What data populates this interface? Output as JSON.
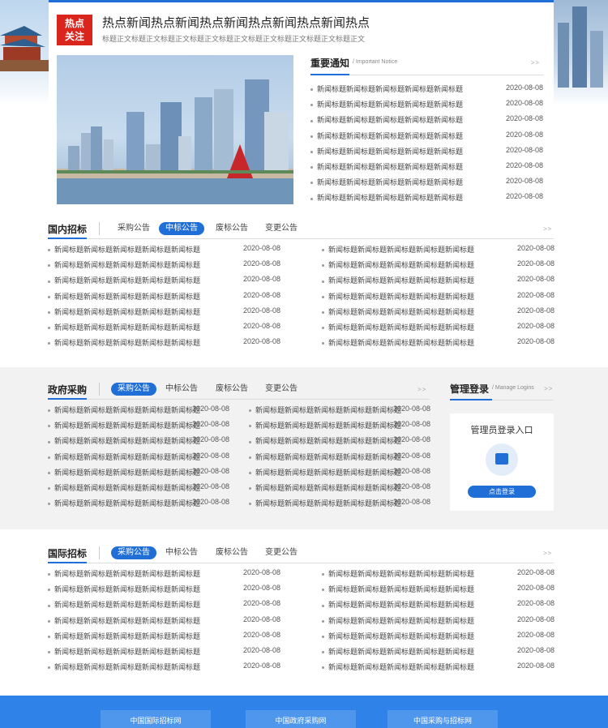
{
  "hot": {
    "badge_line1": "热点",
    "badge_line2": "关注",
    "title": "热点新闻热点新闻热点新闻热点新闻热点新闻热点",
    "subtitle": "标题正文标题正文标题正文标题正文标题正文标题正文标题正文标题正文标题正文"
  },
  "notice": {
    "title": "重要通知",
    "subtitle": "/ Important Notice",
    "more": ">>",
    "items": [
      {
        "text": "新闻标题新闻标题新闻标题新闻标题新闻标题",
        "date": "2020-08-08"
      },
      {
        "text": "新闻标题新闻标题新闻标题新闻标题新闻标题",
        "date": "2020-08-08"
      },
      {
        "text": "新闻标题新闻标题新闻标题新闻标题新闻标题",
        "date": "2020-08-08"
      },
      {
        "text": "新闻标题新闻标题新闻标题新闻标题新闻标题",
        "date": "2020-08-08"
      },
      {
        "text": "新闻标题新闻标题新闻标题新闻标题新闻标题",
        "date": "2020-08-08"
      },
      {
        "text": "新闻标题新闻标题新闻标题新闻标题新闻标题",
        "date": "2020-08-08"
      },
      {
        "text": "新闻标题新闻标题新闻标题新闻标题新闻标题",
        "date": "2020-08-08"
      },
      {
        "text": "新闻标题新闻标题新闻标题新闻标题新闻标题",
        "date": "2020-08-08"
      }
    ]
  },
  "domestic": {
    "title": "国内招标",
    "tabs": [
      "采购公告",
      "中标公告",
      "废标公告",
      "变更公告"
    ],
    "active_tab": 1,
    "more": ">>",
    "item_text": "新闻标题新闻标题新闻标题新闻标题新闻标题",
    "item_date": "2020-08-08",
    "rows": 7
  },
  "gov": {
    "title": "政府采购",
    "tabs": [
      "采购公告",
      "中标公告",
      "废标公告",
      "变更公告"
    ],
    "active_tab": 0,
    "more": ">>",
    "item_text": "新闻标题新闻标题新闻标题新闻标题新闻标题",
    "item_date": "2020-08-08",
    "rows": 7
  },
  "login": {
    "title": "管理登录",
    "subtitle": "/ Manage Logins",
    "more": ">>",
    "box_title": "管理员登录入口",
    "button": "点击登录"
  },
  "intl": {
    "title": "国际招标",
    "tabs": [
      "采购公告",
      "中标公告",
      "废标公告",
      "变更公告"
    ],
    "active_tab": 0,
    "more": ">>",
    "item_text": "新闻标题新闻标题新闻标题新闻标题新闻标题",
    "item_date": "2020-08-08",
    "rows": 7
  },
  "footer": {
    "links": [
      "中国国际招标网",
      "中国政府采购网",
      "中国采购与招标网"
    ]
  },
  "colors": {
    "accent": "#1f6fd6",
    "badge": "#d9251c",
    "footer": "#2f83e8"
  }
}
